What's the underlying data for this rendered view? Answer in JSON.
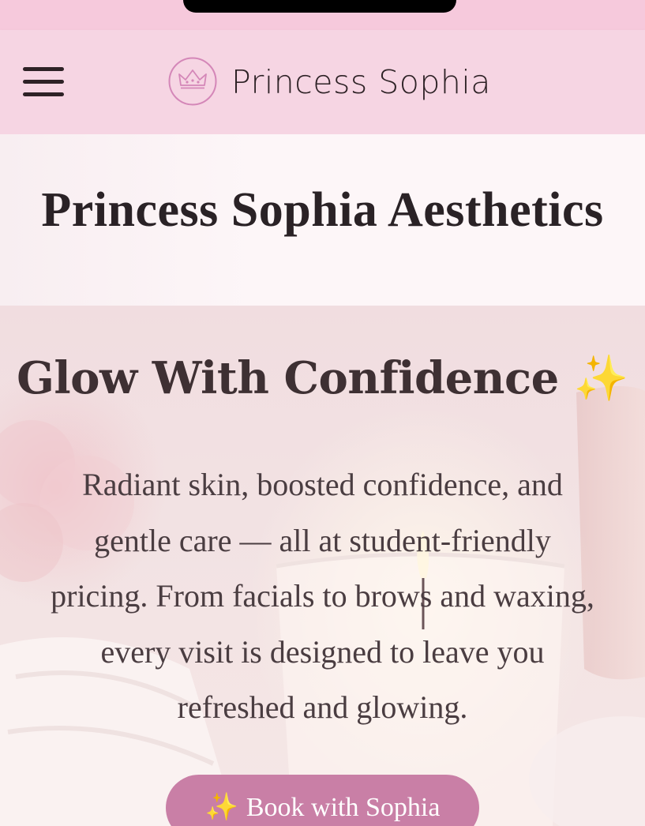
{
  "header": {
    "menu_icon": "hamburger-menu-icon",
    "logo_icon": "crown-icon",
    "brand_name": "Princess Sophia"
  },
  "page": {
    "title": "Princess Sophia Aesthetics"
  },
  "hero": {
    "heading": "Glow With Confidence",
    "heading_emoji": "✨",
    "description": "Radiant skin, boosted confidence, and gentle care — all at student-friendly pricing. From facials to brows and waxing, every visit is designed to leave you refreshed and glowing.",
    "cta_emoji": "✨",
    "cta_label": "Book with Sophia"
  },
  "colors": {
    "header_bg": "#f6d5e3",
    "status_bg": "#f6c9dc",
    "accent": "#c97fa6",
    "text_dark": "#2e2226"
  }
}
